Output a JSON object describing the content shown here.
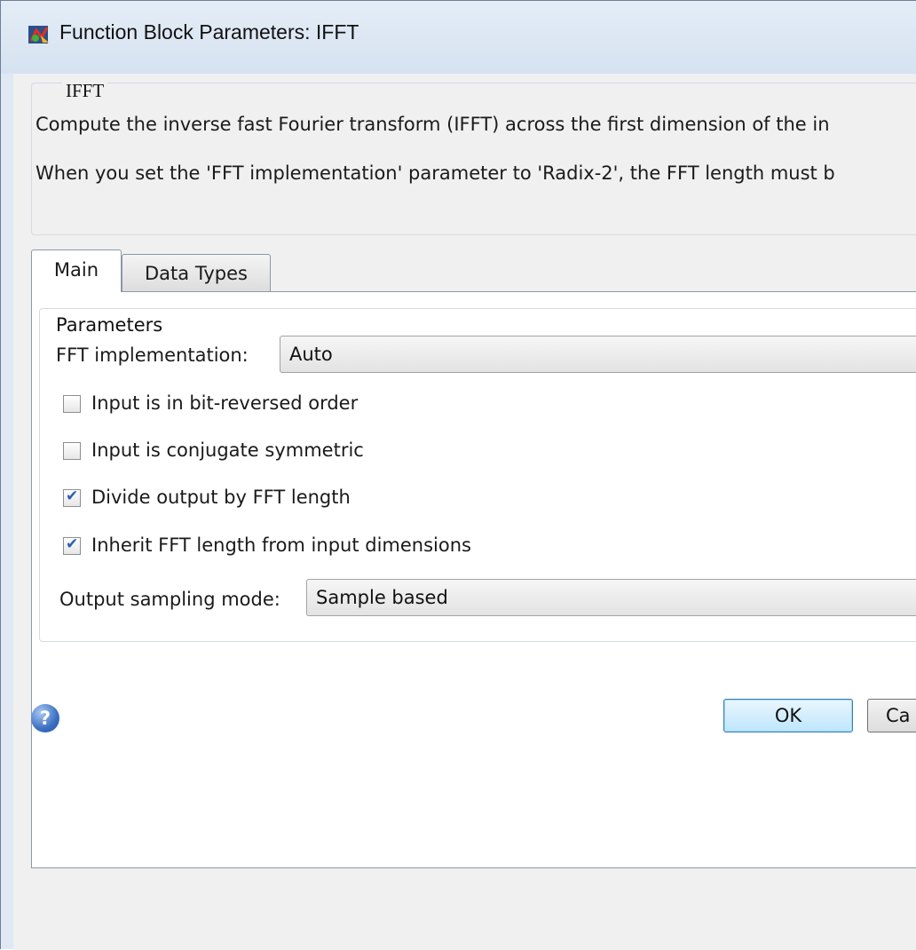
{
  "window": {
    "title": "Function Block Parameters: IFFT"
  },
  "description": {
    "group_title": "IFFT",
    "line1": "Compute the inverse fast Fourier transform (IFFT) across the first dimension of the in",
    "line2": "When you set the 'FFT implementation' parameter to 'Radix-2', the FFT length must b"
  },
  "tabs": [
    {
      "label": "Main",
      "selected": true
    },
    {
      "label": "Data Types",
      "selected": false
    }
  ],
  "parameters": {
    "group_title": "Parameters",
    "fft_implementation": {
      "label": "FFT implementation:",
      "value": "Auto"
    },
    "checkboxes": [
      {
        "label": "Input is in bit-reversed order",
        "checked": false
      },
      {
        "label": "Input is conjugate symmetric",
        "checked": false
      },
      {
        "label": "Divide output by FFT length",
        "checked": true
      },
      {
        "label": "Inherit FFT length from input dimensions",
        "checked": true
      }
    ],
    "output_sampling_mode": {
      "label": "Output sampling mode:",
      "value": "Sample based"
    }
  },
  "buttons": {
    "ok": "OK",
    "cancel": "Ca"
  },
  "icons": {
    "title": "simulink-block-icon",
    "help": "help-icon"
  }
}
